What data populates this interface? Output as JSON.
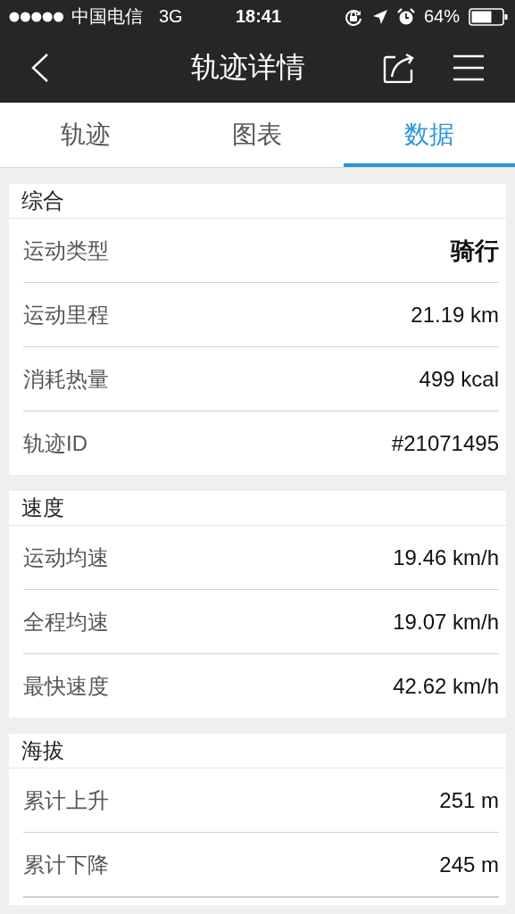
{
  "status_bar": {
    "carrier": "中国电信",
    "network": "3G",
    "time": "18:41",
    "battery": "64%"
  },
  "nav_bar": {
    "title": "轨迹详情"
  },
  "tabs": [
    {
      "label": "轨迹",
      "selected": false
    },
    {
      "label": "图表",
      "selected": false
    },
    {
      "label": "数据",
      "selected": true
    }
  ],
  "sections": [
    {
      "title": "综合",
      "rows": [
        {
          "label": "运动类型",
          "value": "骑行",
          "bold": true
        },
        {
          "label": "运动里程",
          "value": "21.19 km",
          "bold": false
        },
        {
          "label": "消耗热量",
          "value": "499 kcal",
          "bold": false
        },
        {
          "label": "轨迹ID",
          "value": "#21071495",
          "bold": false
        }
      ]
    },
    {
      "title": "速度",
      "rows": [
        {
          "label": "运动均速",
          "value": "19.46 km/h",
          "bold": false
        },
        {
          "label": "全程均速",
          "value": "19.07 km/h",
          "bold": false
        },
        {
          "label": "最快速度",
          "value": "42.62 km/h",
          "bold": false
        }
      ]
    },
    {
      "title": "海拔",
      "rows": [
        {
          "label": "累计上升",
          "value": "251 m",
          "bold": false
        },
        {
          "label": "累计下降",
          "value": "245 m",
          "bold": false
        }
      ]
    }
  ]
}
